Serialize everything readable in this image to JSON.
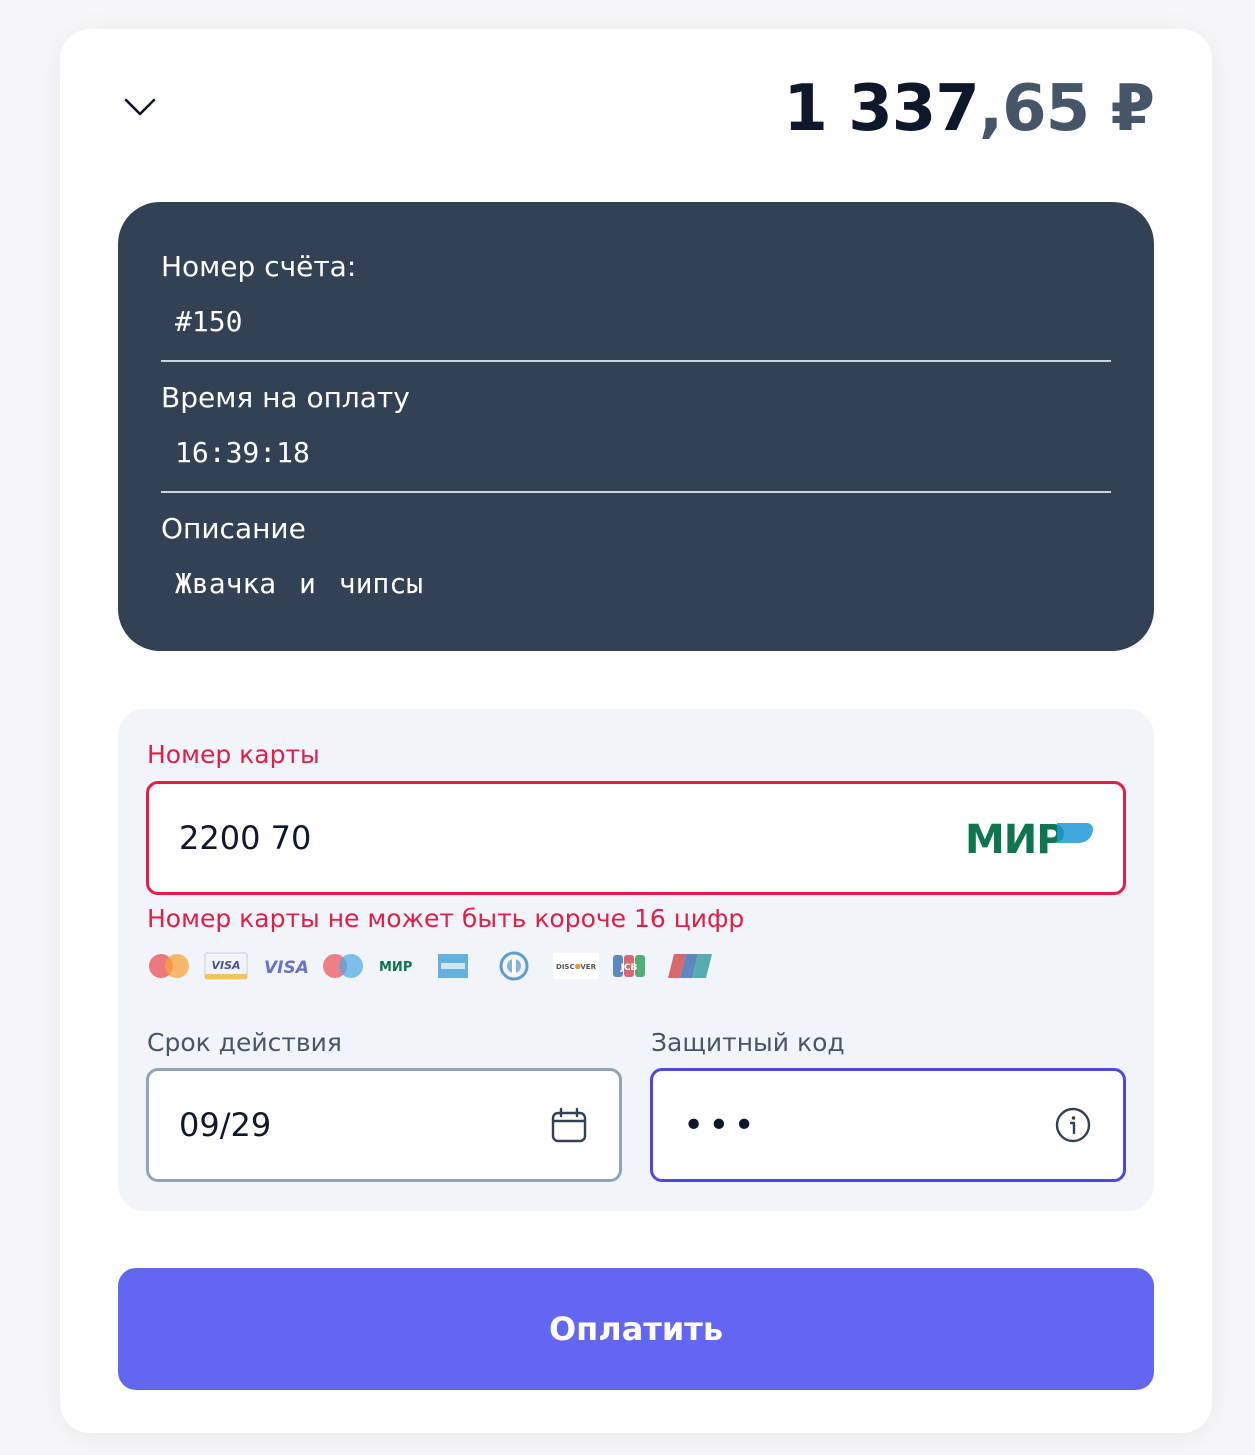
{
  "header": {
    "amount_integer": "1 337",
    "amount_fraction": ",65",
    "currency": "₽",
    "collapse_icon": "chevron-down-icon"
  },
  "invoice": {
    "number_label": "Номер счёта:",
    "number_value": "#150",
    "time_label": "Время на оплату",
    "time_value": "16:39:18",
    "description_label": "Описание",
    "description_value": "Жвачка и чипсы"
  },
  "card_form": {
    "card_number_label": "Номер карты",
    "card_number_value": "2200 70",
    "card_brand_detected": "МИР",
    "card_number_error": "Номер карты не может быть короче 16 цифр",
    "supported_brands": [
      {
        "name": "mastercard-icon"
      },
      {
        "name": "visa-electron-icon",
        "label": "VISA"
      },
      {
        "name": "visa-icon",
        "label": "VISA"
      },
      {
        "name": "maestro-icon"
      },
      {
        "name": "mir-icon",
        "label": "МИР"
      },
      {
        "name": "amex-icon"
      },
      {
        "name": "diners-club-icon"
      },
      {
        "name": "discover-icon",
        "label": "DISCOVER"
      },
      {
        "name": "jcb-icon",
        "label": "JCB"
      },
      {
        "name": "unionpay-icon"
      }
    ],
    "expiry_label": "Срок действия",
    "expiry_value": "09/29",
    "expiry_icon": "calendar-icon",
    "cvc_label": "Защитный код",
    "cvc_value": "•••",
    "cvc_icon": "info-icon"
  },
  "colors": {
    "accent": "#6366f1",
    "error": "#e11d48",
    "invoice_bg": "#334155",
    "focus": "#4f46e5",
    "mir_green": "#0f754e"
  },
  "pay_button": {
    "label": "Оплатить"
  }
}
